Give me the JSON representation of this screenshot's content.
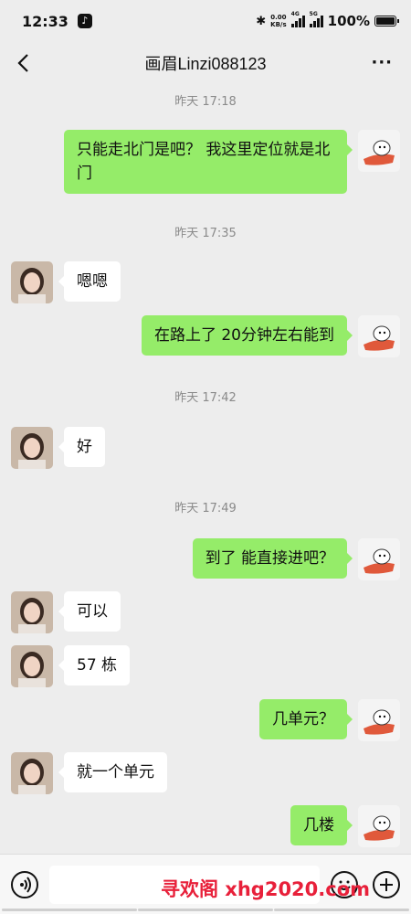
{
  "status": {
    "time": "12:33",
    "speed_top": "0.00",
    "speed_bottom": "KB/s",
    "net1": "4G",
    "net2": "5G",
    "battery": "100%"
  },
  "nav": {
    "title": "画眉Linzi088123",
    "more": "···"
  },
  "messages": [
    {
      "type": "time",
      "text": "昨天 17:18"
    },
    {
      "type": "out",
      "text": "只能走北门是吧？  我这里定位就是北门"
    },
    {
      "type": "time",
      "text": "昨天 17:35"
    },
    {
      "type": "in",
      "text": "嗯嗯"
    },
    {
      "type": "out",
      "text": "在路上了  20分钟左右能到"
    },
    {
      "type": "time",
      "text": "昨天 17:42"
    },
    {
      "type": "in",
      "text": "好"
    },
    {
      "type": "time",
      "text": "昨天 17:49"
    },
    {
      "type": "out",
      "text": "到了 能直接进吧？"
    },
    {
      "type": "in",
      "text": "可以"
    },
    {
      "type": "in",
      "text": "57 栋"
    },
    {
      "type": "out",
      "text": "几单元？"
    },
    {
      "type": "in",
      "text": "就一个单元"
    },
    {
      "type": "out",
      "text": "几楼"
    }
  ],
  "input": {
    "watermark": "寻欢阁 xhg2020.com"
  },
  "colors": {
    "outgoing_bubble": "#95ec69",
    "incoming_bubble": "#ffffff",
    "background": "#ededed",
    "watermark": "#e8203a"
  },
  "icons": [
    "back-arrow-icon",
    "more-icon",
    "voice-icon",
    "emoji-icon",
    "plus-icon",
    "tiktok-icon",
    "bluetooth-icon",
    "signal-icon",
    "battery-icon"
  ]
}
